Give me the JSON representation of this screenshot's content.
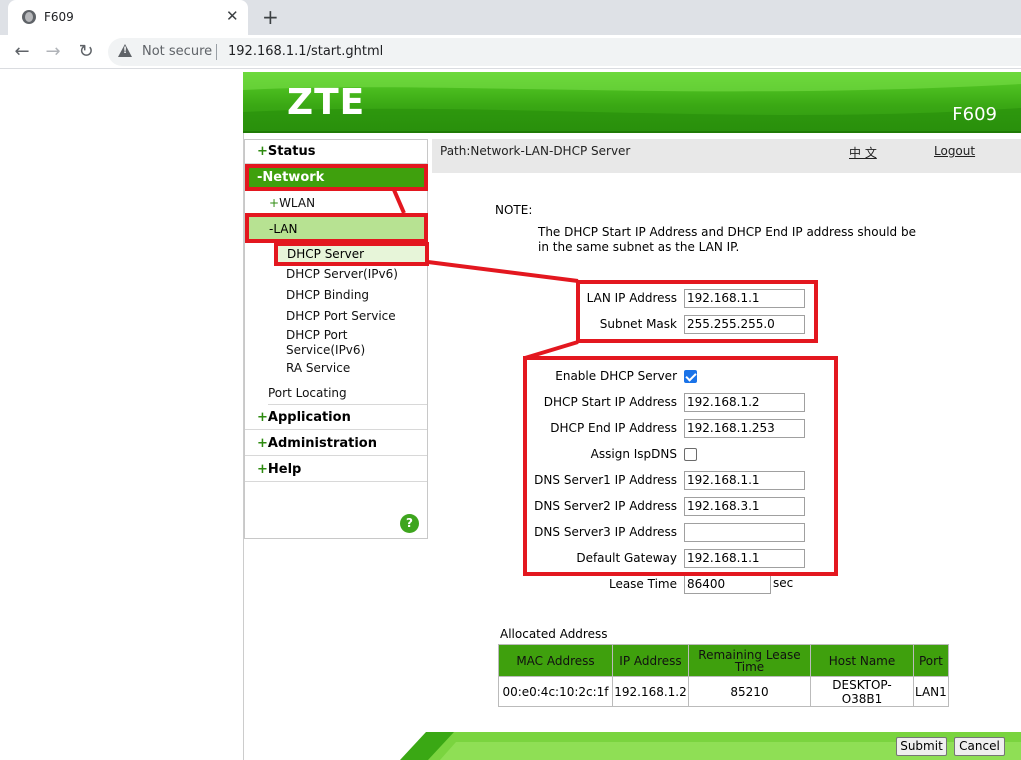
{
  "browser": {
    "tab_title": "F609",
    "tab_close": "✕",
    "new_tab": "+",
    "back": "←",
    "forward": "→",
    "reload": "↻",
    "security_label": "Not secure",
    "url": "192.168.1.1/start.ghtml"
  },
  "header": {
    "logo": "ZTE",
    "model": "F609",
    "brand_color": "#3aa814"
  },
  "sidebar": {
    "status": "Status",
    "network": "-Network",
    "wlan": "WLAN",
    "lan": "-LAN",
    "dhcp_server": "DHCP Server",
    "dhcp_server_ipv6": "DHCP Server(IPv6)",
    "dhcp_binding": "DHCP Binding",
    "dhcp_port_service": "DHCP Port Service",
    "dhcp_port_service_ipv6_a": "DHCP Port",
    "dhcp_port_service_ipv6_b": "Service(IPv6)",
    "ra_service": "RA Service",
    "port_locating": "Port Locating",
    "application": "Application",
    "administration": "Administration",
    "help": "Help",
    "plus": "+",
    "help_icon": "?"
  },
  "pathbar": {
    "path": "Path:Network-LAN-DHCP Server",
    "language": "中 文",
    "logout": "Logout"
  },
  "note": {
    "title": "NOTE:",
    "text": "The DHCP Start IP Address and DHCP End IP address should be in the same subnet as the LAN IP."
  },
  "form": {
    "lan_ip_label": "LAN IP Address",
    "lan_ip": "192.168.1.1",
    "subnet_label": "Subnet Mask",
    "subnet": "255.255.255.0",
    "enable_dhcp_label": "Enable DHCP Server",
    "enable_dhcp_checked": true,
    "start_ip_label": "DHCP Start IP Address",
    "start_ip": "192.168.1.2",
    "end_ip_label": "DHCP End IP Address",
    "end_ip": "192.168.1.253",
    "assign_isp_dns_label": "Assign IspDNS",
    "assign_isp_dns_checked": false,
    "dns1_label": "DNS Server1 IP Address",
    "dns1": "192.168.1.1",
    "dns2_label": "DNS Server2 IP Address",
    "dns2": "192.168.3.1",
    "dns3_label": "DNS Server3 IP Address",
    "dns3": "",
    "gateway_label": "Default Gateway",
    "gateway": "192.168.1.1",
    "lease_label": "Lease Time",
    "lease": "86400",
    "lease_unit": "sec"
  },
  "allocated": {
    "title": "Allocated Address",
    "columns": [
      "MAC Address",
      "IP Address",
      "Remaining Lease Time",
      "Host Name",
      "Port"
    ],
    "rows": [
      [
        "00:e0:4c:10:2c:1f",
        "192.168.1.2",
        "85210",
        "DESKTOP-O38B1",
        "LAN1"
      ]
    ]
  },
  "footer": {
    "submit": "Submit",
    "cancel": "Cancel"
  },
  "colors": {
    "highlight_red": "#e3171f",
    "menu_green": "#3fa00d",
    "menu_light_green": "#b7e292"
  }
}
